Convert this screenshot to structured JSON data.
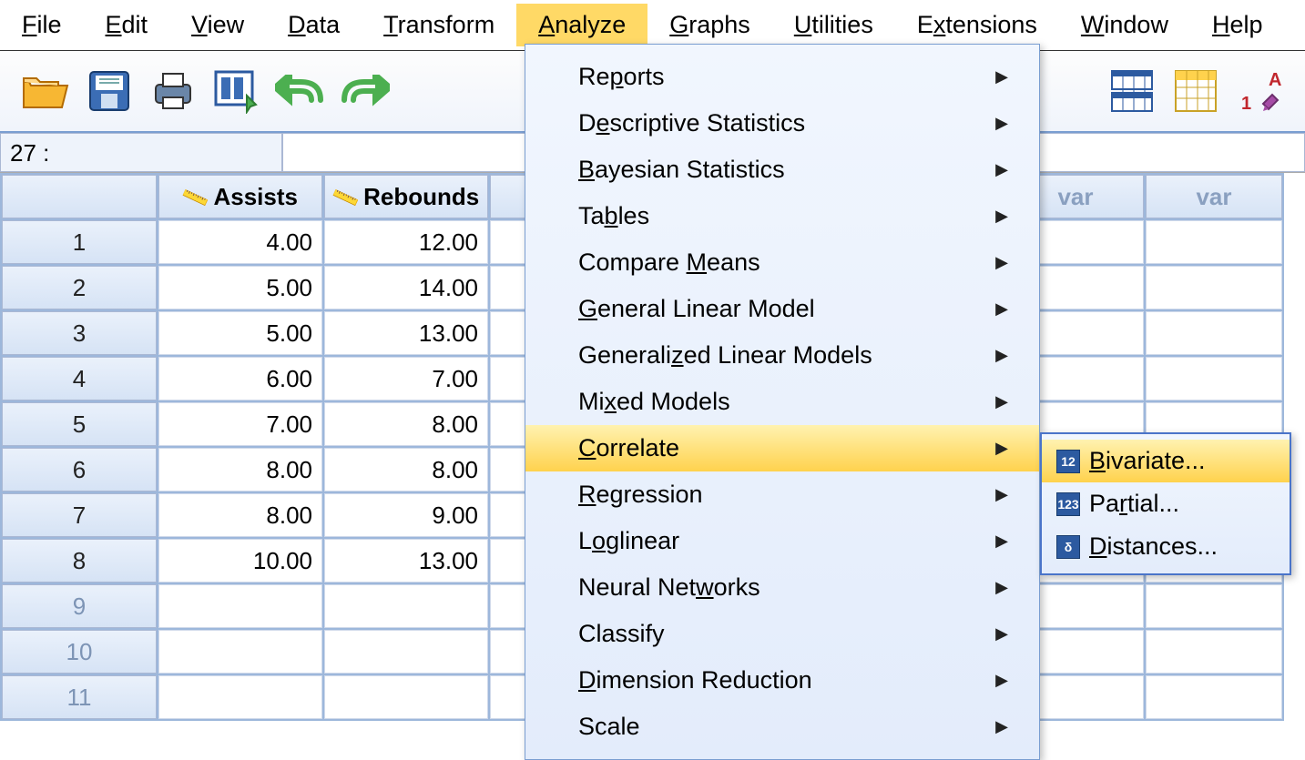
{
  "menubar": [
    {
      "label": "File",
      "mn": "F"
    },
    {
      "label": "Edit",
      "mn": "E"
    },
    {
      "label": "View",
      "mn": "V"
    },
    {
      "label": "Data",
      "mn": "D"
    },
    {
      "label": "Transform",
      "mn": "T"
    },
    {
      "label": "Analyze",
      "mn": "A",
      "active": true
    },
    {
      "label": "Graphs",
      "mn": "G"
    },
    {
      "label": "Utilities",
      "mn": "U"
    },
    {
      "label": "Extensions",
      "mn": "x"
    },
    {
      "label": "Window",
      "mn": "W"
    },
    {
      "label": "Help",
      "mn": "H"
    }
  ],
  "cellref": {
    "label": "27 :"
  },
  "columns": [
    "Assists",
    "Rebounds"
  ],
  "empty_cols": [
    "var",
    "var"
  ],
  "rows": [
    {
      "n": "1",
      "vals": [
        "4.00",
        "12.00"
      ]
    },
    {
      "n": "2",
      "vals": [
        "5.00",
        "14.00"
      ]
    },
    {
      "n": "3",
      "vals": [
        "5.00",
        "13.00"
      ]
    },
    {
      "n": "4",
      "vals": [
        "6.00",
        "7.00"
      ]
    },
    {
      "n": "5",
      "vals": [
        "7.00",
        "8.00"
      ]
    },
    {
      "n": "6",
      "vals": [
        "8.00",
        "8.00"
      ]
    },
    {
      "n": "7",
      "vals": [
        "8.00",
        "9.00"
      ]
    },
    {
      "n": "8",
      "vals": [
        "10.00",
        "13.00"
      ]
    },
    {
      "n": "9",
      "vals": [
        "",
        ""
      ]
    },
    {
      "n": "10",
      "vals": [
        "",
        ""
      ]
    },
    {
      "n": "11",
      "vals": [
        "",
        ""
      ]
    }
  ],
  "dropdown": [
    {
      "label": "Reports",
      "mn": "p"
    },
    {
      "label": "Descriptive Statistics",
      "mn": "e"
    },
    {
      "label": "Bayesian Statistics",
      "mn": "B"
    },
    {
      "label": "Tables",
      "mn": "b"
    },
    {
      "label": "Compare Means",
      "mn": "M"
    },
    {
      "label": "General Linear Model",
      "mn": "G"
    },
    {
      "label": "Generalized Linear Models",
      "mn": "z"
    },
    {
      "label": "Mixed Models",
      "mn": "x"
    },
    {
      "label": "Correlate",
      "mn": "C",
      "hover": true
    },
    {
      "label": "Regression",
      "mn": "R"
    },
    {
      "label": "Loglinear",
      "mn": "o"
    },
    {
      "label": "Neural Networks",
      "mn": "w"
    },
    {
      "label": "Classify",
      "mn": "F"
    },
    {
      "label": "Dimension Reduction",
      "mn": "D"
    },
    {
      "label": "Scale",
      "mn": "A"
    }
  ],
  "submenu": [
    {
      "label": "Bivariate...",
      "mn": "B",
      "icon": "12",
      "hover": true
    },
    {
      "label": "Partial...",
      "mn": "r",
      "icon": "123"
    },
    {
      "label": "Distances...",
      "mn": "D",
      "icon": "δ"
    }
  ],
  "toolbar_icons": [
    "open",
    "save",
    "print",
    "recall",
    "undo",
    "redo",
    "variables",
    "values",
    "labels"
  ]
}
